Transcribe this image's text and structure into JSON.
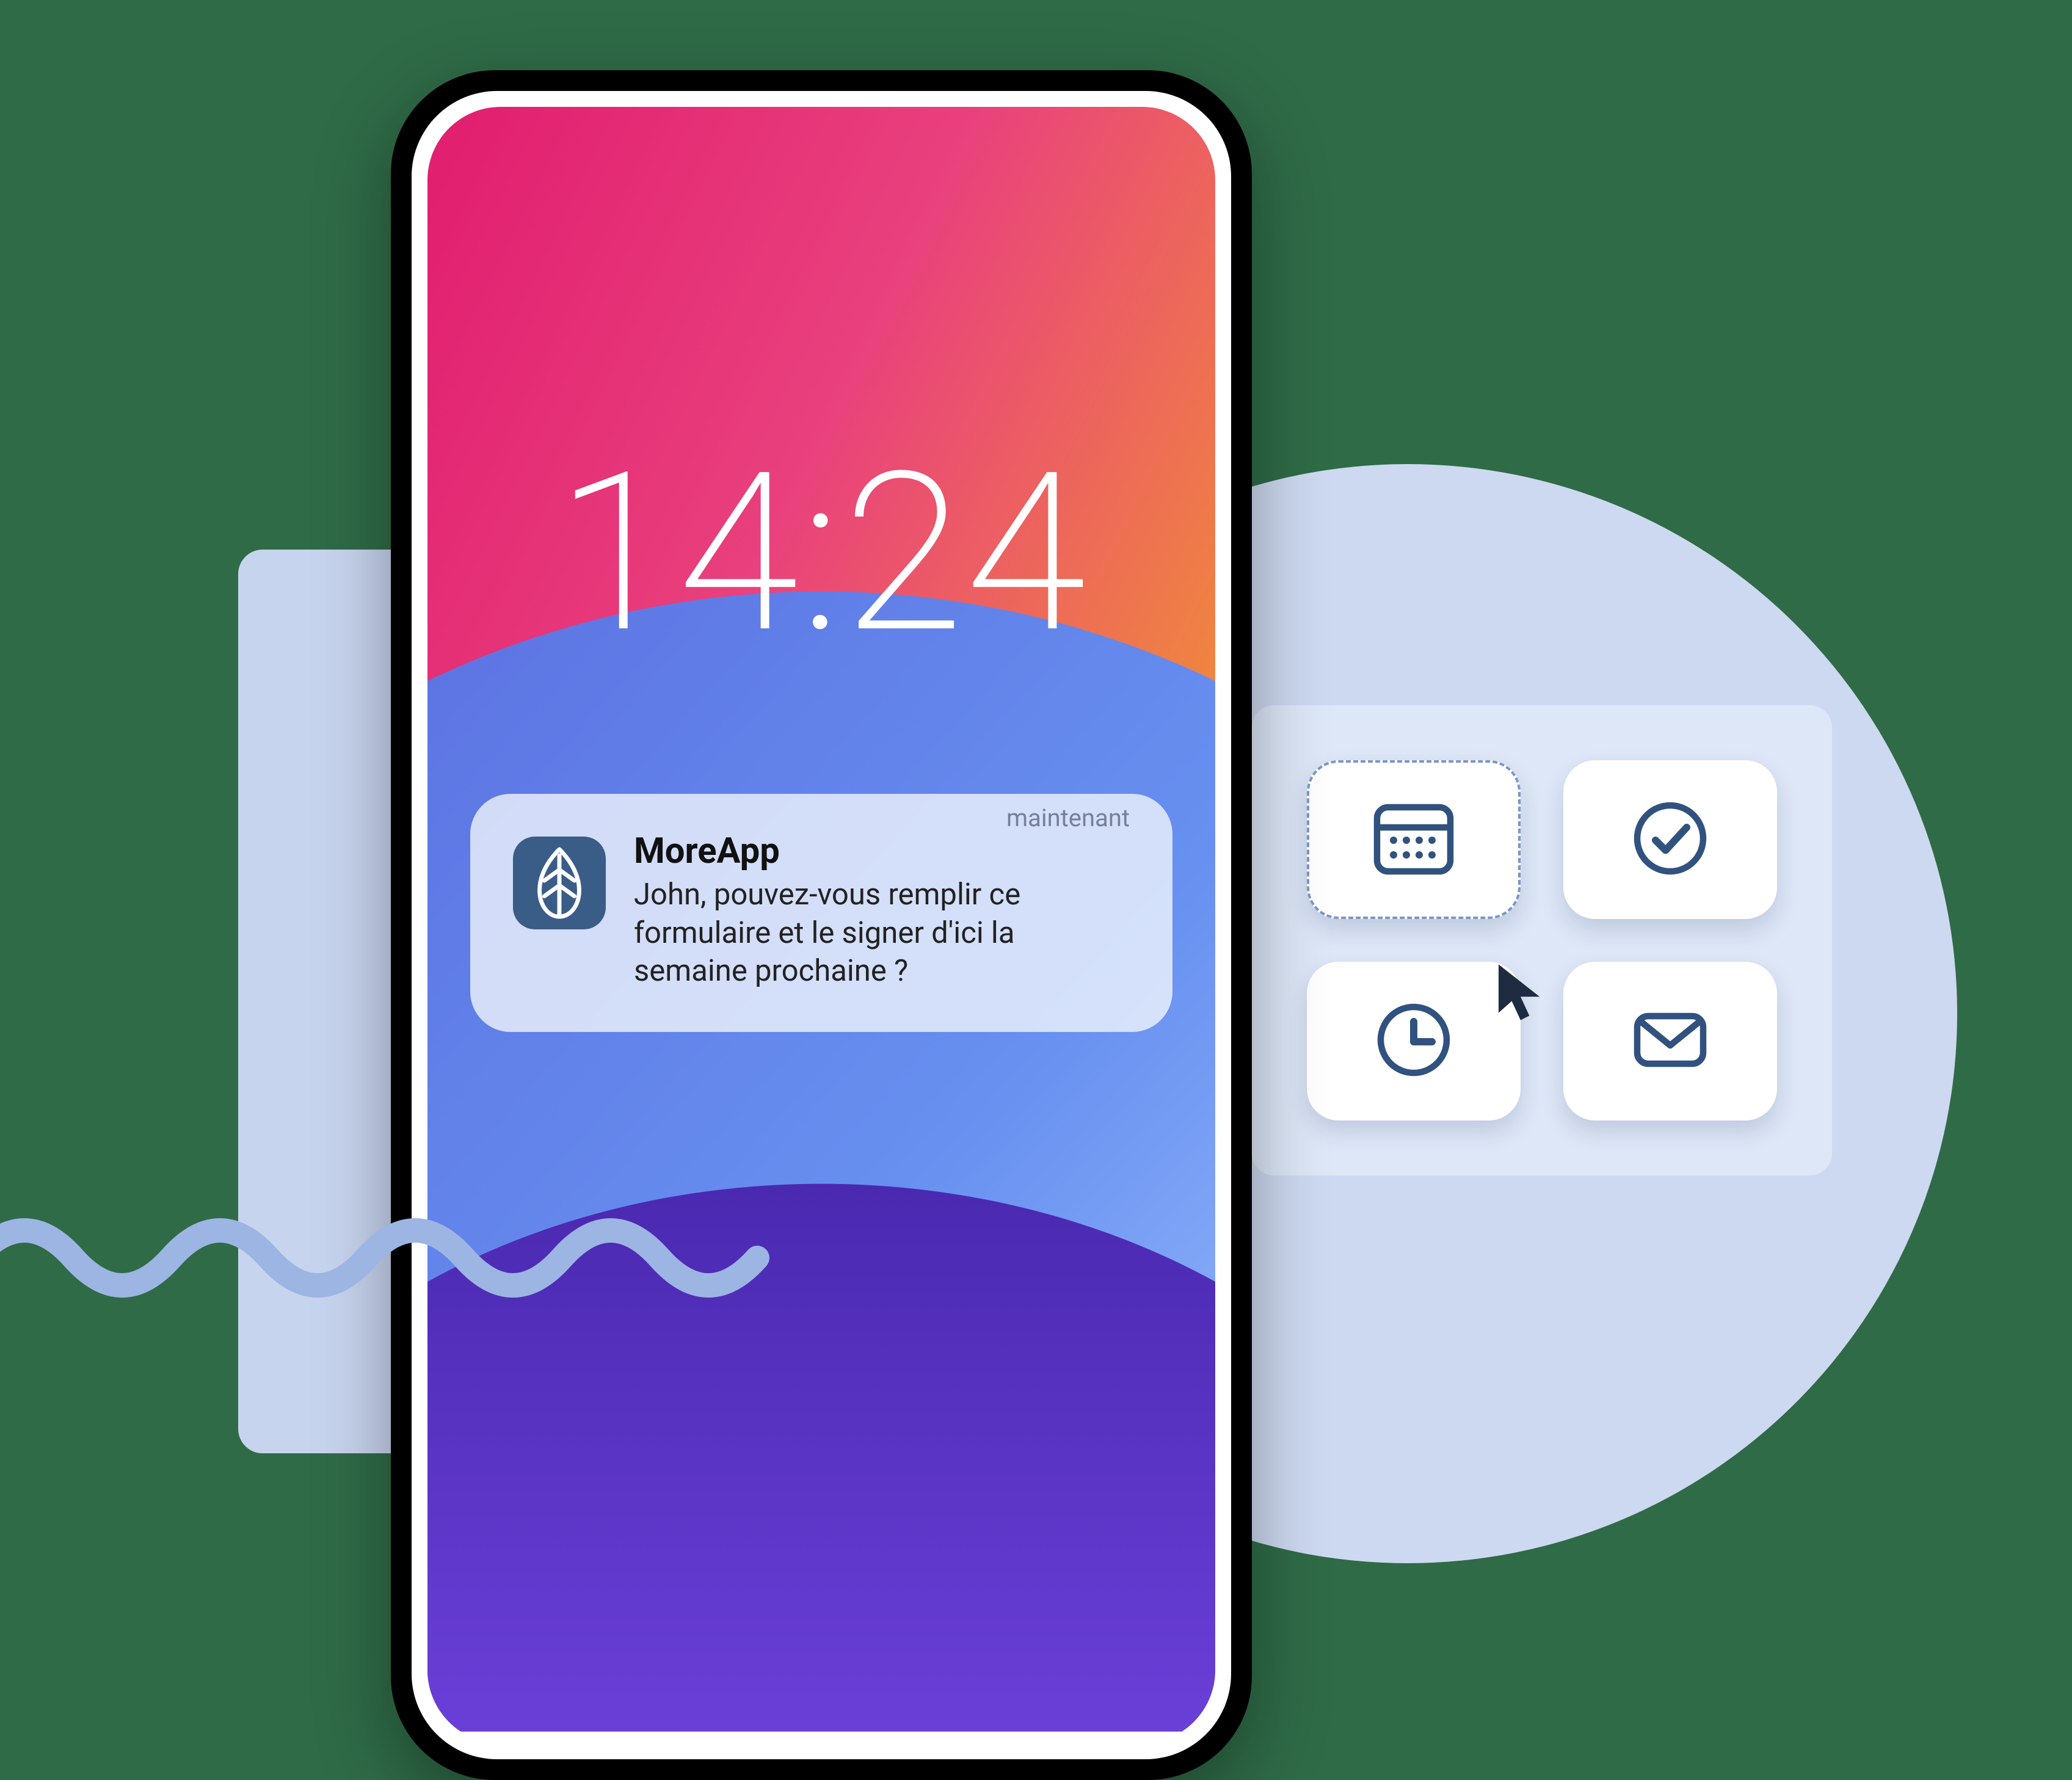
{
  "lockscreen": {
    "time": "14:24"
  },
  "notification": {
    "app_name": "MoreApp",
    "timestamp_label": "maintenant",
    "body": "John, pouvez-vous remplir ce formulaire et le signer d'ici la semaine prochaine ?"
  },
  "tiles": {
    "calendar_label": "calendar",
    "check_label": "check",
    "clock_label": "clock",
    "mail_label": "mail"
  }
}
